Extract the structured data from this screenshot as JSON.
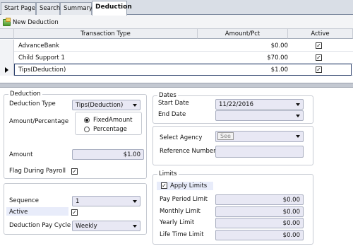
{
  "tabs": [
    {
      "label": "Start Page"
    },
    {
      "label": "Search"
    },
    {
      "label": "Summary"
    },
    {
      "label": "Deduction"
    }
  ],
  "toolbar": {
    "new_deduction_label": "New Deduction",
    "icon": "add-document-icon"
  },
  "grid": {
    "columns": [
      "Transaction Type",
      "Amount/Pct",
      "Active"
    ],
    "rows": [
      {
        "type": "AdvanceBank",
        "amount": "$0.00",
        "active": true
      },
      {
        "type": "Child Support 1",
        "amount": "$70.00",
        "active": true
      },
      {
        "type": "Tips(Deduction)",
        "amount": "$1.00",
        "active": true
      }
    ]
  },
  "deduction": {
    "group_label": "Deduction",
    "type_label": "Deduction Type",
    "type_value": "Tips(Deduction)",
    "amount_pct_label": "Amount/Percentage",
    "radio_fixed": "FixedAmount",
    "radio_percentage": "Percentage",
    "selected_radio": "FixedAmount",
    "amount_label": "Amount",
    "amount_value": "$1.00",
    "flag_label": "Flag During Payroll",
    "flag_checked": true
  },
  "sequence": {
    "sequence_label": "Sequence",
    "sequence_value": "1",
    "active_label": "Active",
    "active_checked": true,
    "pay_cycle_label": "Deduction Pay Cycle",
    "pay_cycle_value": "Weekly"
  },
  "dates": {
    "group_label": "Dates",
    "start_label": "Start Date",
    "start_value": "11/22/2016",
    "end_label": "End Date",
    "end_value": ""
  },
  "agency": {
    "select_label": "Select Agency",
    "see_button": "See",
    "reference_label": "Reference Number",
    "reference_value": ""
  },
  "limits": {
    "group_label": "Limits",
    "apply_label": "Apply Limits",
    "apply_checked": true,
    "pay_period_label": "Pay Period Limit",
    "pay_period_value": "$0.00",
    "monthly_label": "Monthly Limit",
    "monthly_value": "$0.00",
    "yearly_label": "Yearly Limit",
    "yearly_value": "$0.00",
    "lifetime_label": "Life Time Limit",
    "lifetime_value": "$0.00"
  }
}
